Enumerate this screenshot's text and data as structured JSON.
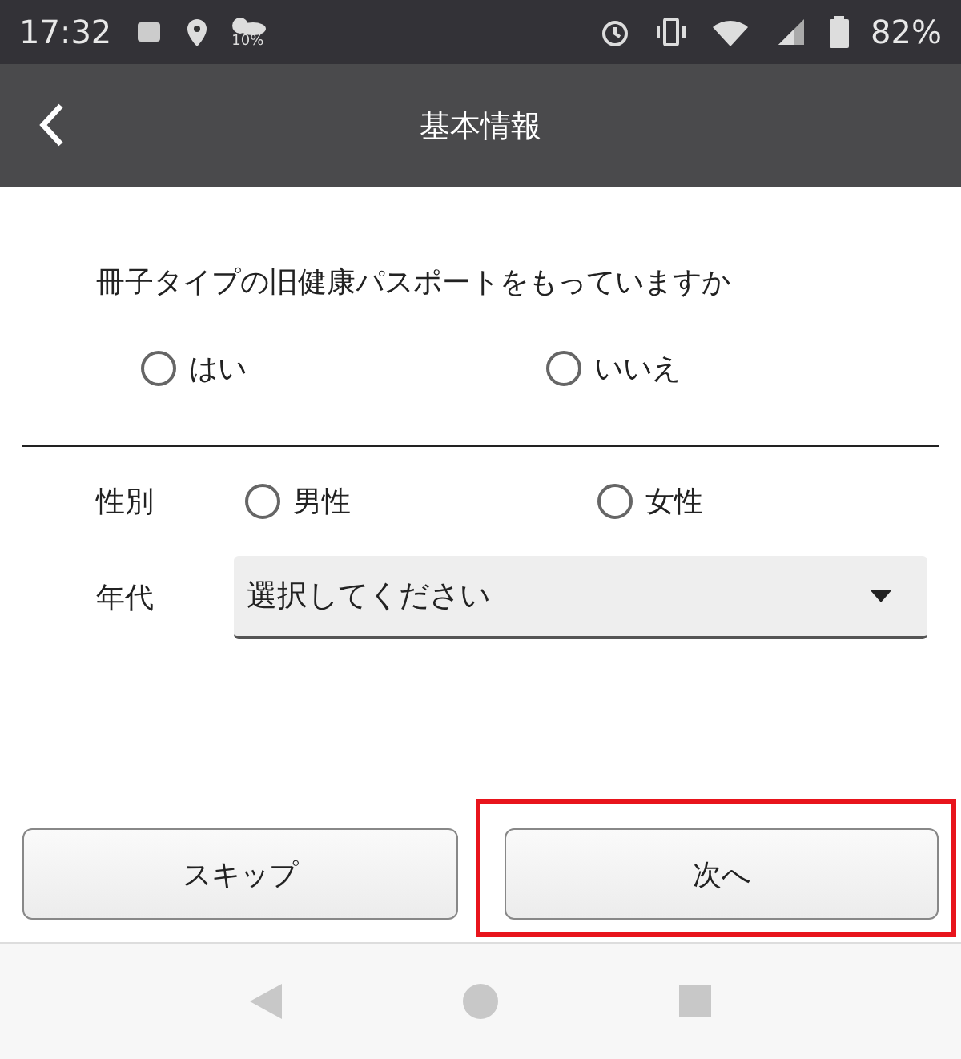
{
  "status_bar": {
    "time": "17:32",
    "weather_percent": "10%",
    "battery": "82%"
  },
  "header": {
    "title": "基本情報"
  },
  "question": {
    "text": "冊子タイプの旧健康パスポートをもっていますか",
    "options": [
      {
        "label": "はい",
        "selected": false
      },
      {
        "label": "いいえ",
        "selected": false
      }
    ]
  },
  "gender": {
    "label": "性別",
    "options": [
      {
        "label": "男性",
        "selected": false
      },
      {
        "label": "女性",
        "selected": false
      }
    ]
  },
  "age": {
    "label": "年代",
    "placeholder": "選択してください"
  },
  "buttons": [
    {
      "label": "スキップ",
      "highlighted": false
    },
    {
      "label": "次へ",
      "highlighted": true
    }
  ]
}
